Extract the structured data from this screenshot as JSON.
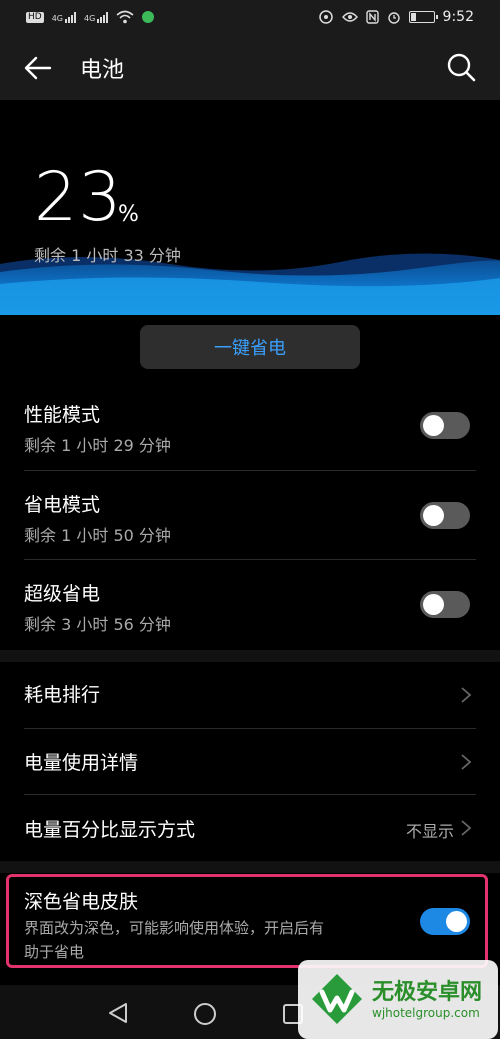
{
  "status_bar": {
    "left_tags": [
      "HD",
      "4G",
      "4G"
    ],
    "time": "9:52"
  },
  "app_bar": {
    "title": "电池"
  },
  "battery": {
    "percent": "23",
    "percent_sign": "%",
    "remaining": "剩余 1 小时 33 分钟"
  },
  "one_key_save": {
    "label": "一键省电"
  },
  "modes": [
    {
      "title": "性能模式",
      "subtitle": "剩余 1 小时 29 分钟",
      "enabled": false
    },
    {
      "title": "省电模式",
      "subtitle": "剩余 1 小时 50 分钟",
      "enabled": false
    },
    {
      "title": "超级省电",
      "subtitle": "剩余 3 小时 56 分钟",
      "enabled": false
    }
  ],
  "menu": [
    {
      "title": "耗电排行"
    },
    {
      "title": "电量使用详情"
    },
    {
      "title": "电量百分比显示方式",
      "value": "不显示"
    }
  ],
  "dark_skin": {
    "title": "深色省电皮肤",
    "line1": "界面改为深色，可能影响使用体验，开启后有",
    "line2": "助于省电",
    "enabled": true
  },
  "colors": {
    "accent": "#1e88e5",
    "highlight": "#e2336c",
    "button_text": "#3aa0ff"
  },
  "watermark": {
    "title": "无极安卓网",
    "url": "wjhotelgroup.com"
  }
}
